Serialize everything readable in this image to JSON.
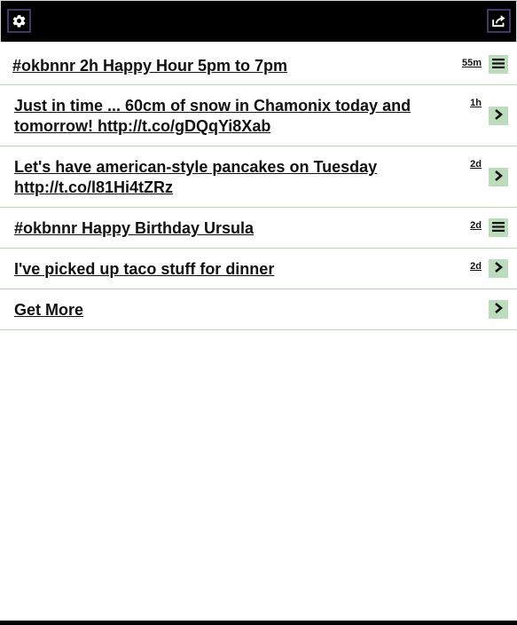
{
  "toolbar": {
    "settings_icon": "gear-icon",
    "share_icon": "share-icon"
  },
  "feed": {
    "items": [
      {
        "title": "#okbnnr 2h Happy Hour 5pm to 7pm",
        "time": "55m",
        "action_icon": "menu-icon"
      },
      {
        "title": "Just in time ... 60cm of snow in Chamonix today and tomorrow! http://t.co/gDQqYi8Xab",
        "time": "1h",
        "action_icon": "chevron-right-icon"
      },
      {
        "title": "Let's have american-style pancakes on Tuesday http://t.co/l81Hi4tZRz",
        "time": "2d",
        "action_icon": "chevron-right-icon"
      },
      {
        "title": "#okbnnr Happy Birthday Ursula",
        "time": "2d",
        "action_icon": "menu-icon"
      },
      {
        "title": "I've picked up taco stuff for dinner",
        "time": "2d",
        "action_icon": "chevron-right-icon"
      }
    ],
    "get_more_label": "Get More"
  },
  "colors": {
    "topbar": "#000000",
    "button_border": "#3c3a6a",
    "row_divider": "#b9d6b3",
    "action_bg": "#bcdcbc"
  }
}
